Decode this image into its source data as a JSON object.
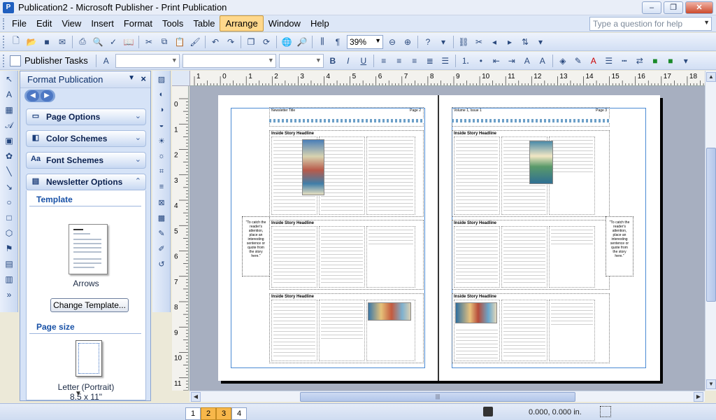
{
  "window": {
    "title": "Publication2 - Microsoft Publisher - Print Publication",
    "minimize": "–",
    "restore": "❐",
    "close": "✕"
  },
  "menu": {
    "items": [
      "File",
      "Edit",
      "View",
      "Insert",
      "Format",
      "Tools",
      "Table",
      "Arrange",
      "Window",
      "Help"
    ],
    "active": "Arrange",
    "help_placeholder": "Type a question for help"
  },
  "toolbar": {
    "zoom": "39%",
    "publisher_tasks": "Publisher Tasks"
  },
  "taskpane": {
    "title": "Format Publication",
    "sections": [
      {
        "label": "Page Options",
        "icon": "page-icon"
      },
      {
        "label": "Color Schemes",
        "icon": "palette-icon"
      },
      {
        "label": "Font Schemes",
        "icon": "font-icon",
        "glyph": "Aa"
      },
      {
        "label": "Newsletter Options",
        "icon": "newsletter-icon"
      }
    ],
    "template_heading": "Template",
    "template_name": "Arrows",
    "change_template_button": "Change Template...",
    "page_size_heading": "Page size",
    "page_size_name": "Letter (Portrait)",
    "page_size_dims": "8.5 x 11\""
  },
  "rulers": {
    "h_ticks": [
      "1",
      "0",
      "1",
      "2",
      "3",
      "4",
      "5",
      "6",
      "7",
      "8",
      "9",
      "10",
      "11",
      "12",
      "13",
      "14",
      "15",
      "16",
      "17",
      "18"
    ],
    "v_ticks": [
      "0",
      "1",
      "2",
      "3",
      "4",
      "5",
      "6",
      "7",
      "8",
      "9",
      "10",
      "11"
    ]
  },
  "document": {
    "left_page": {
      "header_left": "Newsletter Title",
      "header_right": "Page 2",
      "story_headline": "Inside Story Headline",
      "pullquote": "\"To catch the reader's attention, place an interesting sentence or quote from the story here.\""
    },
    "right_page": {
      "header_left": "Volume 1, Issue 1",
      "header_right": "Page 3",
      "story_headline": "Inside Story Headline",
      "pullquote": "\"To catch the reader's attention, place an interesting sentence or quote from the story here.\""
    }
  },
  "statusbar": {
    "pages": [
      "1",
      "2",
      "3",
      "4"
    ],
    "active_pages": [
      "2",
      "3"
    ],
    "coordinates": "0.000, 0.000 in."
  }
}
